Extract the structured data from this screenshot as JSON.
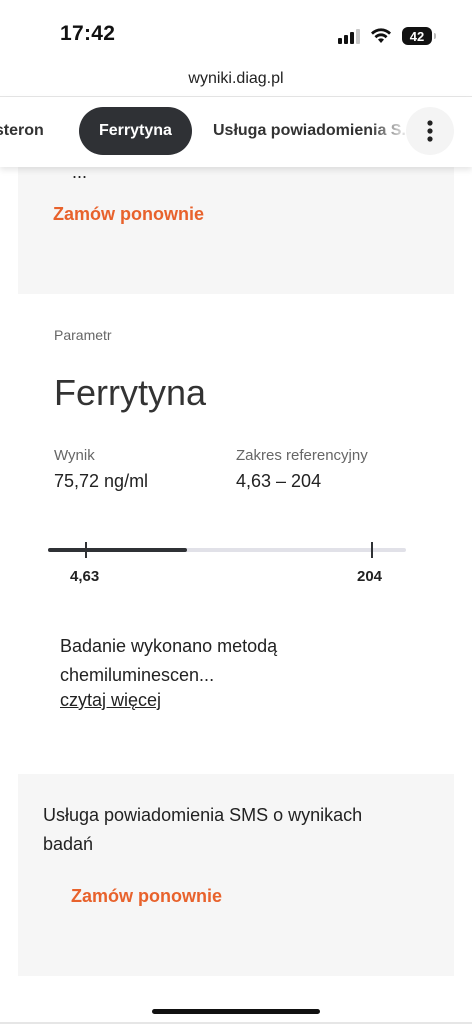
{
  "status": {
    "time": "17:42",
    "battery": "42"
  },
  "browser": {
    "url": "wyniki.diag.pl"
  },
  "tabs": [
    {
      "label": "esteron"
    },
    {
      "label": "Ferrytyna"
    },
    {
      "label": "Usługa powiadomienia S..."
    }
  ],
  "top_card": {
    "cut_text": "...",
    "order_label": "Zamów ponownie"
  },
  "result": {
    "param_label": "Parametr",
    "param_name": "Ferrytyna",
    "result_label": "Wynik",
    "result_value": "75,72 ng/ml",
    "range_label": "Zakres referencyjny",
    "range_value": "4,63 – 204",
    "range_min_label": "4,63",
    "range_max_label": "204",
    "bar": {
      "min": 4.63,
      "max": 204,
      "value": 75.72
    },
    "description": "Badanie wykonano metodą chemiluminescen...",
    "read_more": "czytaj więcej"
  },
  "sms_card": {
    "text": "Usługa powiadomienia SMS o wynikach badań",
    "order_label": "Zamów ponownie"
  },
  "colors": {
    "accent": "#e8622c",
    "dark": "#2f3135",
    "card": "#f6f6f6"
  }
}
